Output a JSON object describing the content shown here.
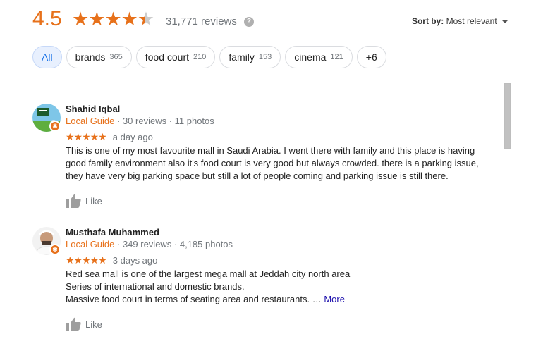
{
  "summary": {
    "rating": "4.5",
    "stars_value": 4.5,
    "reviews": "31,771 reviews",
    "help_icon": "question-icon"
  },
  "sort": {
    "label": "Sort by:",
    "value": "Most relevant"
  },
  "chips": [
    {
      "label": "All",
      "count": ""
    },
    {
      "label": "brands",
      "count": "365"
    },
    {
      "label": "food court",
      "count": "210"
    },
    {
      "label": "family",
      "count": "153"
    },
    {
      "label": "cinema",
      "count": "121"
    },
    {
      "label": "+6",
      "count": ""
    }
  ],
  "reviews": [
    {
      "name": "Shahid Iqbal",
      "guide": "Local Guide",
      "meta": " · 30 reviews · 11 photos",
      "stars": "★★★★★",
      "date": "a day ago",
      "lines": [
        "This is one of my most favourite mall in Saudi Arabia. I went there with family and this place is having",
        "good family environment also it's food court is very good but always crowded. there is a parking issue,",
        "they have very big parking space but still a lot of people coming and parking issue is still there."
      ],
      "more": "",
      "like": "Like"
    },
    {
      "name": "Musthafa Muhammed",
      "guide": "Local Guide",
      "meta": " · 349 reviews · 4,185 photos",
      "stars": "★★★★★",
      "date": "3 days ago",
      "lines": [
        "Red sea mall is one of the largest mega mall at Jeddah city north area",
        "Series of international and domestic brands.",
        "Massive food court in terms of seating area and restaurants. … "
      ],
      "more": "More",
      "like": "Like"
    }
  ],
  "colors": {
    "accent": "#e7711b",
    "link": "#1a0dab",
    "chip_active": "#1a73e8"
  }
}
